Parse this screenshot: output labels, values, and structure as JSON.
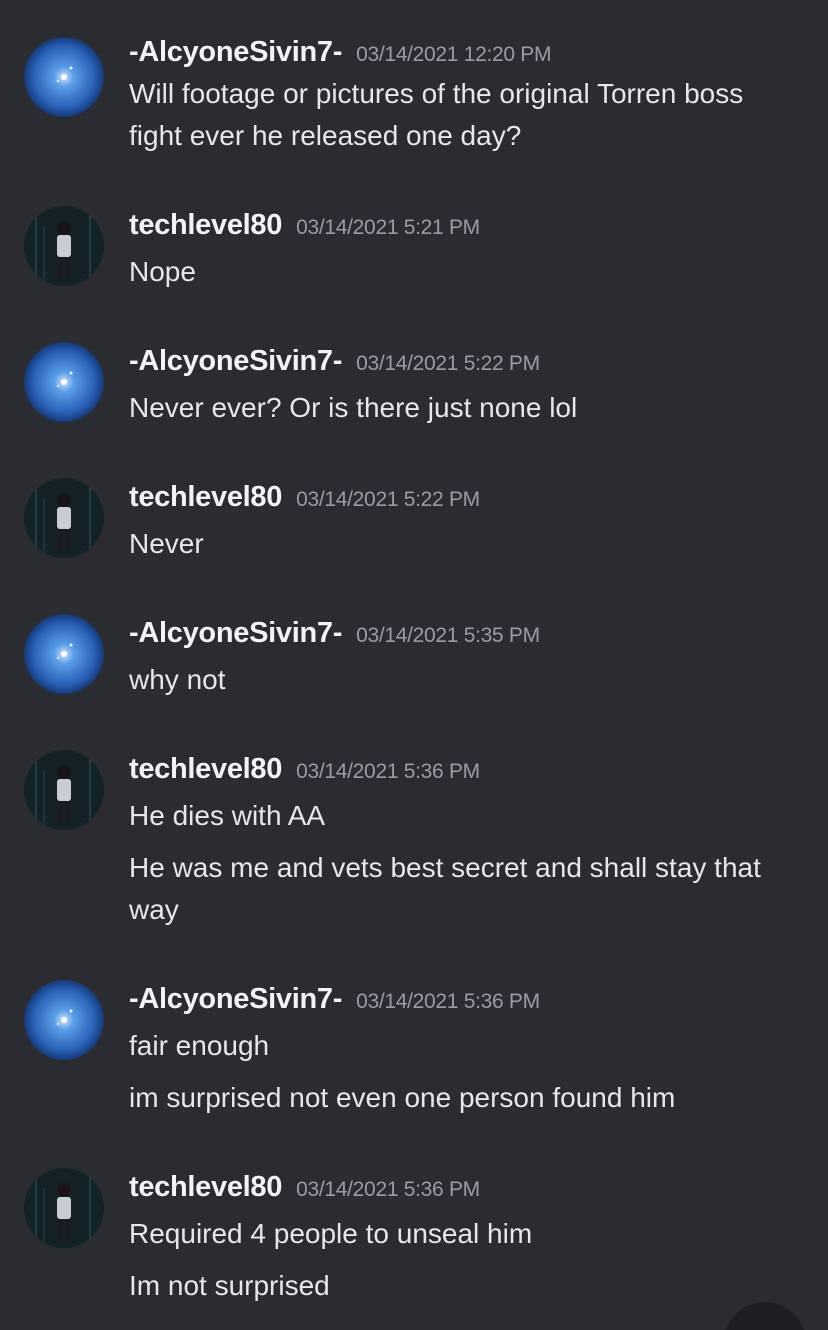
{
  "messages": [
    {
      "author": "-AlcyoneSivin7-",
      "avatar": "blue-orb-icon",
      "timestamp": "03/14/2021 12:20 PM",
      "lines": [
        "Will footage or pictures of the  original Torren boss fight ever he released one day?"
      ]
    },
    {
      "author": "techlevel80",
      "avatar": "dark-character-icon",
      "timestamp": "03/14/2021 5:21 PM",
      "lines": [
        "Nope"
      ]
    },
    {
      "author": "-AlcyoneSivin7-",
      "avatar": "blue-orb-icon",
      "timestamp": "03/14/2021 5:22 PM",
      "lines": [
        "Never ever? Or is there just none lol"
      ]
    },
    {
      "author": "techlevel80",
      "avatar": "dark-character-icon",
      "timestamp": "03/14/2021 5:22 PM",
      "lines": [
        "Never"
      ]
    },
    {
      "author": "-AlcyoneSivin7-",
      "avatar": "blue-orb-icon",
      "timestamp": "03/14/2021 5:35 PM",
      "lines": [
        "why not"
      ]
    },
    {
      "author": "techlevel80",
      "avatar": "dark-character-icon",
      "timestamp": "03/14/2021 5:36 PM",
      "lines": [
        "He dies with AA",
        "He was me and vets best secret and shall stay that way"
      ]
    },
    {
      "author": "-AlcyoneSivin7-",
      "avatar": "blue-orb-icon",
      "timestamp": "03/14/2021 5:36 PM",
      "lines": [
        "fair enough",
        "im surprised not even one person found him"
      ]
    },
    {
      "author": "techlevel80",
      "avatar": "dark-character-icon",
      "timestamp": "03/14/2021 5:36 PM",
      "lines": [
        "Required 4 people to unseal him",
        "Im not surprised"
      ]
    }
  ],
  "colors": {
    "background": "#2b2c31",
    "username": "#f2f3f5",
    "timestamp": "#9a9ca3",
    "text": "#e6e7ea"
  }
}
